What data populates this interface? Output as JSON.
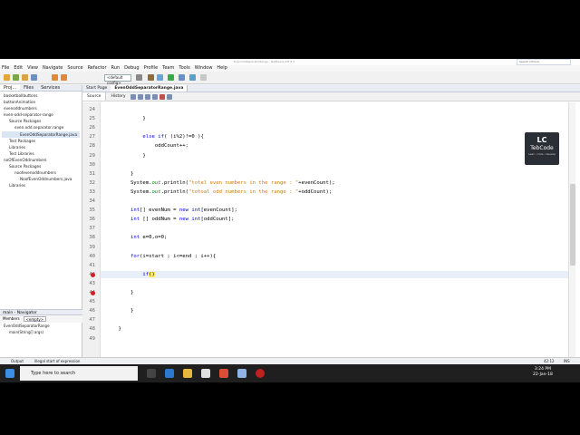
{
  "window": {
    "title": "EvenOddSeparatorRange - NetBeans IDE 8.2",
    "search_placeholder": "Search (Ctrl+I)"
  },
  "menu": [
    "File",
    "Edit",
    "View",
    "Navigate",
    "Source",
    "Refactor",
    "Run",
    "Debug",
    "Profile",
    "Team",
    "Tools",
    "Window",
    "Help"
  ],
  "toolbar": {
    "config": "<default config>"
  },
  "left": {
    "tabs": [
      "Proj...",
      "Files",
      "Services"
    ],
    "tree": [
      "basketballbuttons",
      "buttonAnimation",
      "evenoddnumbers",
      "even-odd-separator-range",
      "Source Packages",
      "even.odd.separator.range",
      "EvenOddSeparatorRange.java",
      "Test Packages",
      "Libraries",
      "Test Libraries",
      "noOfEvenOddnumbers",
      "Source Packages",
      "noofevenoddnumbers",
      "NoofEvenOddnumbers.java",
      "Libraries"
    ],
    "navigator_title": "main - Navigator",
    "navigator_members": "Members",
    "navigator_filter": "<empty>",
    "nav_items": [
      "EvenOddSeparatorRange",
      "main(String[] args)"
    ]
  },
  "editor": {
    "tabs": [
      "Start Page",
      "EvenOddSeparatorRange.java"
    ],
    "subtabs": [
      "Source",
      "History"
    ],
    "lines": [
      {
        "n": "24",
        "code": ""
      },
      {
        "n": "25",
        "code": "            }"
      },
      {
        "n": "26",
        "code": ""
      },
      {
        "n": "27",
        "code": "            else if( (i%2)!=0 ){"
      },
      {
        "n": "28",
        "code": "                oddCount++;"
      },
      {
        "n": "29",
        "code": "            }"
      },
      {
        "n": "30",
        "code": ""
      },
      {
        "n": "31",
        "code": "        }"
      },
      {
        "n": "32",
        "code": "        System.out.println(\"total even numbers in the range : \"+evenCount);"
      },
      {
        "n": "33",
        "code": "        System.out.println(\"totoal odd numbers in the range : \"+oddCount);"
      },
      {
        "n": "34",
        "code": ""
      },
      {
        "n": "35",
        "code": "        int[] evenNum = new int[evenCount];"
      },
      {
        "n": "36",
        "code": "        int [] oddNum = new int[oddCount];"
      },
      {
        "n": "37",
        "code": ""
      },
      {
        "n": "38",
        "code": "        int e=0,o=0;"
      },
      {
        "n": "39",
        "code": ""
      },
      {
        "n": "40",
        "code": "        for(i=start ; i<=end ; i++){"
      },
      {
        "n": "41",
        "code": ""
      },
      {
        "n": "42",
        "code": "            if()"
      },
      {
        "n": "43",
        "code": ""
      },
      {
        "n": "44",
        "code": "        }"
      },
      {
        "n": "45",
        "code": ""
      },
      {
        "n": "46",
        "code": "        }"
      },
      {
        "n": "47",
        "code": ""
      },
      {
        "n": "48",
        "code": "    }"
      },
      {
        "n": "49",
        "code": ""
      }
    ]
  },
  "status": {
    "output": "Output",
    "message": "illegal start of expression",
    "position": "42:12",
    "mode": "INS"
  },
  "taskbar": {
    "search_placeholder": "Type here to search",
    "time": "3:24 PM",
    "date": "22-Jan-18"
  },
  "watermark": {
    "mark": "LC",
    "name": "TebCode",
    "tagline": "Learn • Code • Develop"
  }
}
